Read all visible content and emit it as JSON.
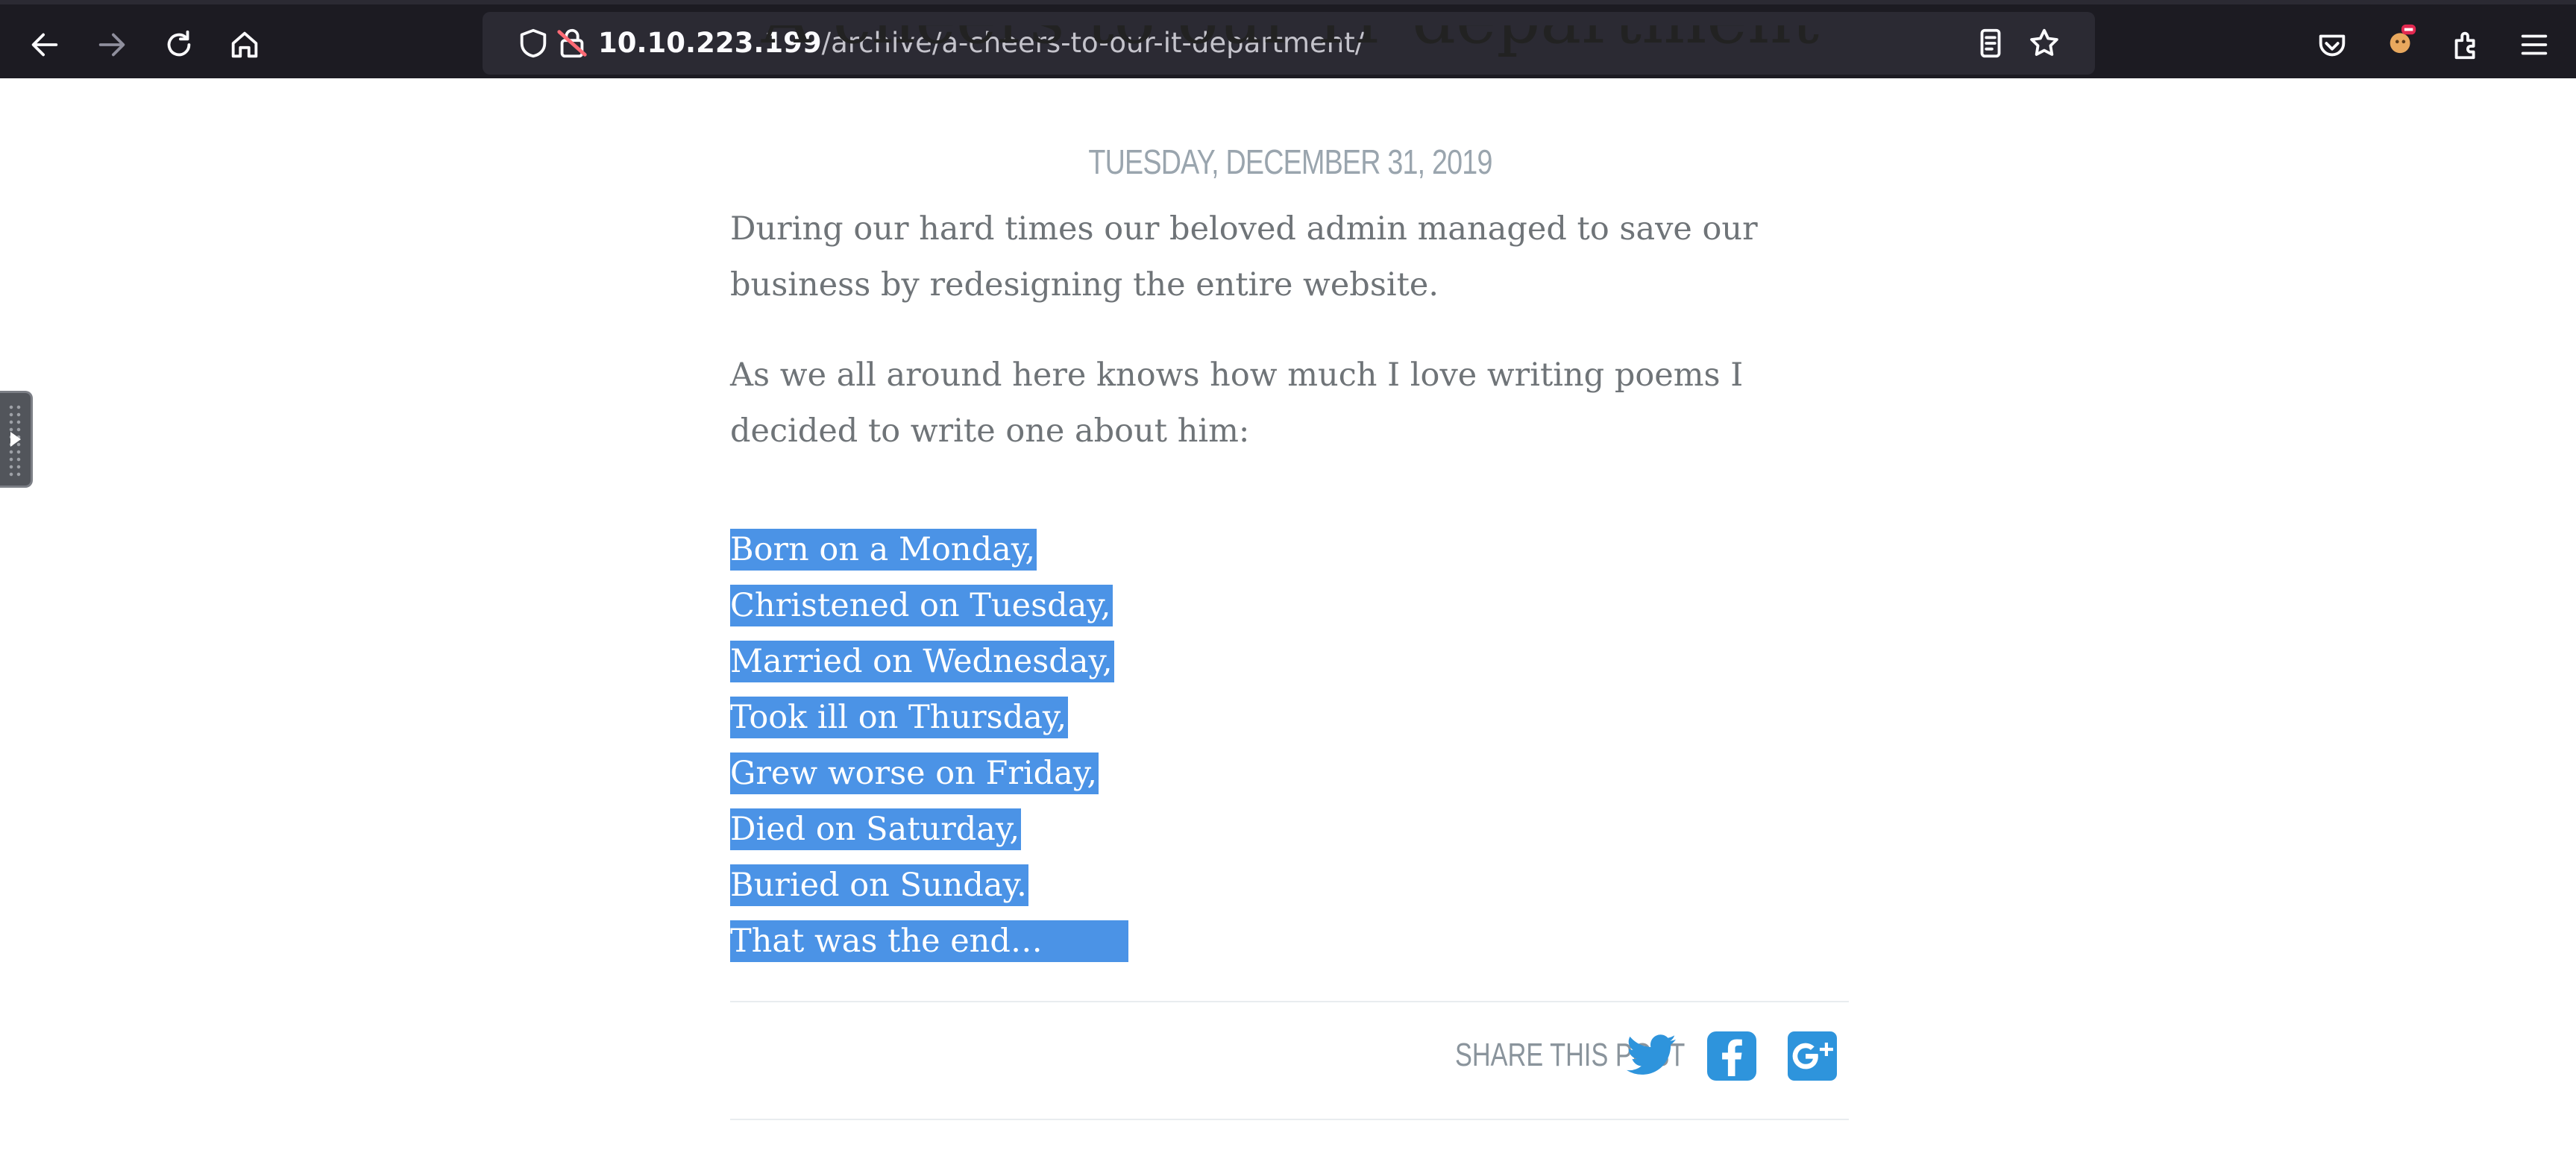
{
  "browser": {
    "url_host": "10.10.223.199",
    "url_path": "/archive/a-cheers-to-our-it-department/",
    "nav_icons": [
      "back-icon",
      "forward-icon",
      "reload-icon",
      "home-icon"
    ],
    "right_icons": [
      "pocket-icon",
      "profile-icon",
      "extensions-icon",
      "menu-icon"
    ]
  },
  "article": {
    "title": "A cheers to our IT department",
    "date": "TUESDAY, DECEMBER 31, 2019",
    "paragraphs": [
      "During our hard times our beloved admin managed to save our business by redesigning the entire website.",
      "As we all around here knows how much I love writing poems I decided to write one about him:"
    ],
    "poem": [
      "Born on a Monday,",
      "Christened on Tuesday,",
      "Married on Wednesday,",
      "Took ill on Thursday,",
      "Grew worse on Friday,",
      "Died on Saturday,",
      "Buried on Sunday.",
      "That was the end…"
    ]
  },
  "share": {
    "label": "SHARE THIS POST",
    "icons": [
      "twitter-icon",
      "facebook-icon",
      "google-plus-icon"
    ]
  },
  "colors": {
    "toolbar": "#1c1b22",
    "selection": "#4b93e6",
    "body_text": "#6f7478",
    "share_blue": "#2e94dc"
  }
}
